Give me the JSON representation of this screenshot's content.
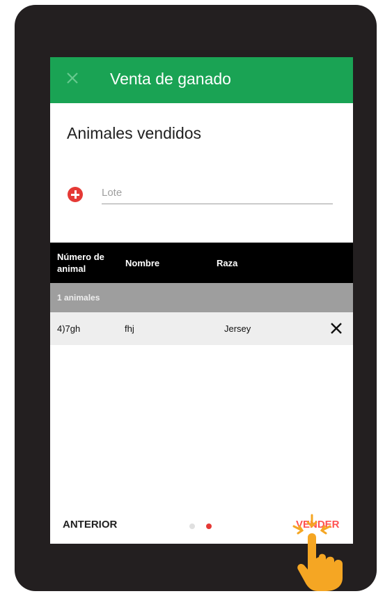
{
  "appbar": {
    "title": "Venta de ganado",
    "close_icon": "close-icon"
  },
  "section": {
    "title": "Animales vendidos"
  },
  "lote": {
    "placeholder": "Lote",
    "add_icon": "add-circle-icon"
  },
  "table": {
    "headers": [
      "Número de animal",
      "Nombre",
      "Raza"
    ],
    "group_label": "1 animales",
    "rows": [
      {
        "numero": "4)7gh",
        "nombre": "fhj",
        "raza": "Jersey",
        "remove_icon": "close-icon"
      }
    ]
  },
  "footer": {
    "previous_label": "ANTERIOR",
    "next_label": "VENDER",
    "page_indicator": {
      "count": 2,
      "active": 2
    }
  },
  "colors": {
    "appbar": "#1aa354",
    "accent": "#e53935",
    "table_header": "#000000",
    "group_row": "#9e9e9e",
    "tap_hand": "#f5a623"
  },
  "overlay": {
    "icon": "tap-hand-icon"
  }
}
